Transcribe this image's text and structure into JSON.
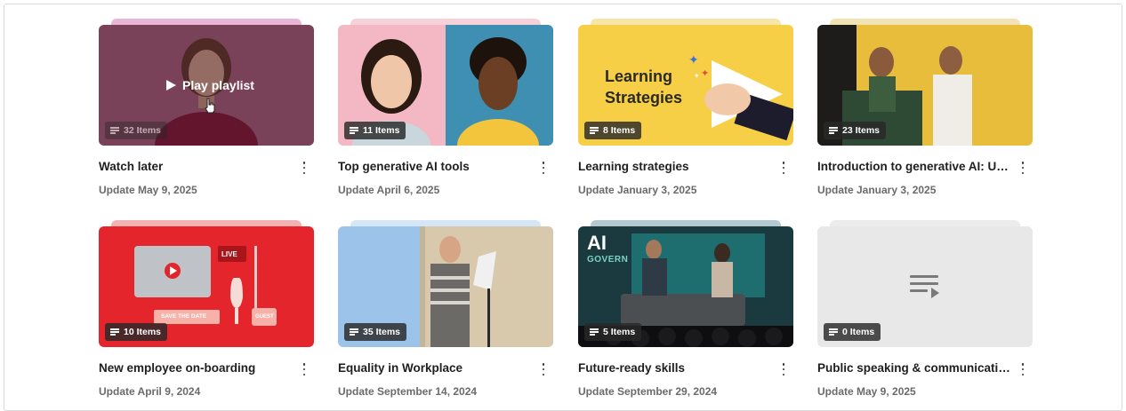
{
  "overlay": {
    "play_label": "Play playlist"
  },
  "playlists": [
    {
      "title": "Watch later",
      "updated": "Update May 9, 2025",
      "items": "32 Items",
      "stack_color": "#e9b6d6"
    },
    {
      "title": "Top generative AI tools",
      "updated": "Update April 6, 2025",
      "items": "11 Items",
      "stack_color": "#f6d2d8"
    },
    {
      "title": "Learning strategies",
      "updated": "Update January 3, 2025",
      "items": "8 Items",
      "thumb_text_1": "Learning",
      "thumb_text_2": "Strategies",
      "stack_color": "#f7e6a6"
    },
    {
      "title": "Introduction to generative AI: Understanding the Basics",
      "updated": "Update January 3, 2025",
      "items": "23 Items",
      "stack_color": "#f1e3b3"
    },
    {
      "title": "New employee on-boarding",
      "updated": "Update April 9, 2024",
      "items": "10 Items",
      "thumb_live": "LIVE",
      "thumb_save": "SAVE THE DATE",
      "thumb_guest": "GUEST",
      "stack_color": "#f4b3b3"
    },
    {
      "title": "Equality in Workplace",
      "updated": "Update September 14, 2024",
      "items": "35 Items",
      "stack_color": "#d5e7f7"
    },
    {
      "title": "Future-ready skills",
      "updated": "Update September 29, 2024",
      "items": "5 Items",
      "thumb_ai": "AI",
      "thumb_govern": "GOVERN",
      "stack_color": "#b3c9cf"
    },
    {
      "title": "Public speaking & communication skills",
      "updated": "Update May 9, 2025",
      "items": "0 Items",
      "stack_color": "#ececec"
    }
  ],
  "colors": {
    "title_text": "#1f1f1f",
    "meta_text": "#6b6b6b",
    "badge_bg": "#2e2e2e"
  }
}
